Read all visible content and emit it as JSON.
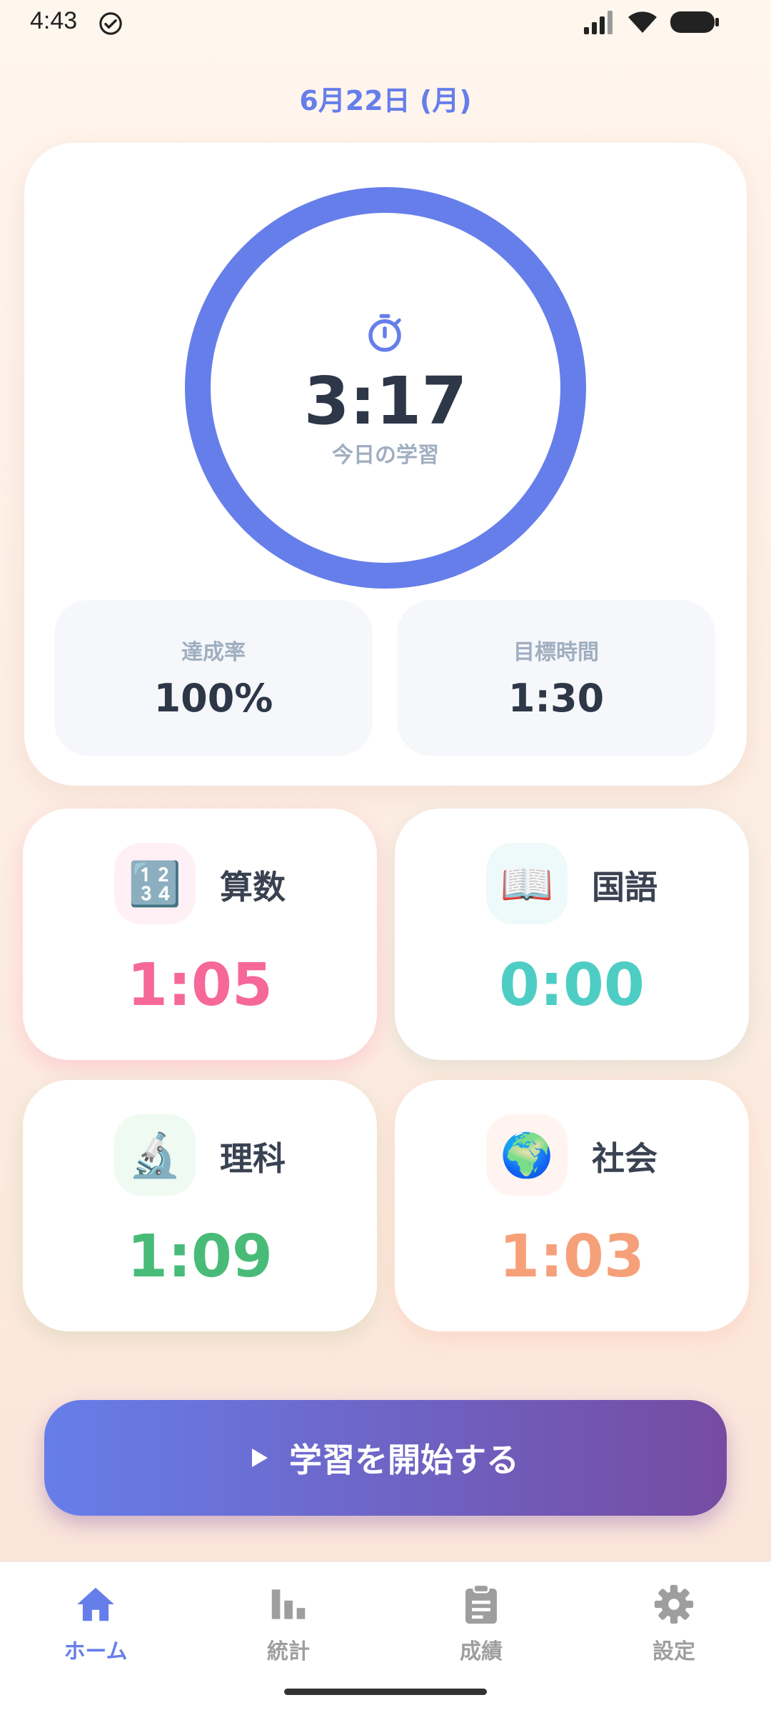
{
  "status_bar": {
    "time": "4:43"
  },
  "header": {
    "date": "6月22日 (月)"
  },
  "today": {
    "time": "3:17",
    "label": "今日の学習",
    "progress": 1.0,
    "ring_color": "#667eea",
    "stats": [
      {
        "label": "達成率",
        "value": "100%"
      },
      {
        "label": "目標時間",
        "value": "1:30"
      }
    ]
  },
  "subjects": [
    {
      "name": "算数",
      "time": "1:05",
      "icon": "🔢",
      "icon_name": "numbers-icon",
      "color": "#f6679a",
      "icon_bg": "#fff0f5"
    },
    {
      "name": "国語",
      "time": "0:00",
      "icon": "📖",
      "icon_name": "book-icon",
      "color": "#4ecdc4",
      "icon_bg": "#eefaf9"
    },
    {
      "name": "理科",
      "time": "1:09",
      "icon": "🔬",
      "icon_name": "microscope-icon",
      "color": "#48bb78",
      "icon_bg": "#eefaf2"
    },
    {
      "name": "社会",
      "time": "1:03",
      "icon": "🌍",
      "icon_name": "globe-icon",
      "color": "#f6a07a",
      "icon_bg": "#fff4ef"
    }
  ],
  "start_button": {
    "label": "学習を開始する"
  },
  "nav": [
    {
      "label": "ホーム",
      "icon": "home-icon",
      "active": true
    },
    {
      "label": "統計",
      "icon": "bar-chart-icon",
      "active": false
    },
    {
      "label": "成績",
      "icon": "clipboard-icon",
      "active": false
    },
    {
      "label": "設定",
      "icon": "gear-icon",
      "active": false
    }
  ],
  "colors": {
    "accent": "#667eea",
    "inactive": "#9e9e9e"
  }
}
